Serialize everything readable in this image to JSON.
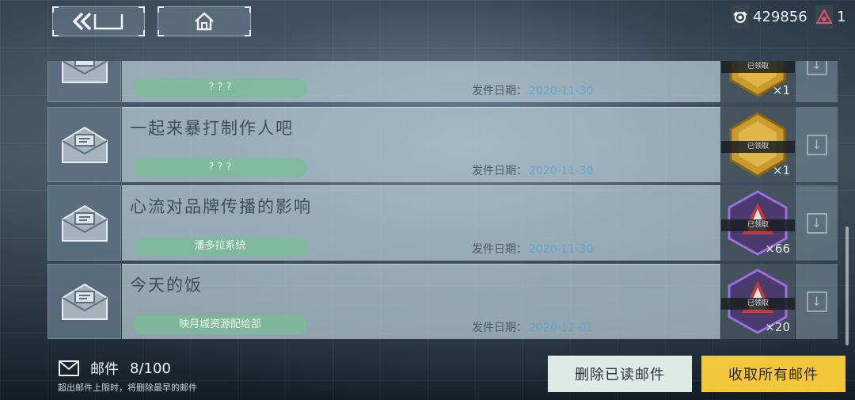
{
  "header": {
    "currency_1": "429856",
    "currency_2": "1"
  },
  "mails": [
    {
      "title": "",
      "sender": "? ? ?",
      "date_label": "发件日期：",
      "date": "2020-11-30",
      "reward_status": "已领取",
      "reward_count": "×1",
      "reward_type": "gold-coin"
    },
    {
      "title": "一起来暴打制作人吧",
      "sender": "? ? ?",
      "date_label": "发件日期：",
      "date": "2020-11-30",
      "reward_status": "已领取",
      "reward_count": "×1",
      "reward_type": "gold-coin"
    },
    {
      "title": "心流对品牌传播的影响",
      "sender": "潘多拉系统",
      "date_label": "发件日期：",
      "date": "2020-11-30",
      "reward_status": "已领取",
      "reward_count": "×66",
      "reward_type": "purple-crystal"
    },
    {
      "title": "今天的饭",
      "sender": "映月城资源配给部",
      "date_label": "发件日期：",
      "date": "2020-12-01",
      "reward_status": "已领取",
      "reward_count": "×20",
      "reward_type": "purple-crystal"
    }
  ],
  "footer": {
    "mail_label": "邮件",
    "mail_count": "8/100",
    "note": "超出邮件上限时，将删除最早的邮件",
    "delete_read_label": "删除已读邮件",
    "claim_all_label": "收取所有邮件"
  },
  "colors": {
    "claim_all_button": "#f3c73a",
    "delete_button": "#dfe9e6",
    "sender_pill": "#78be96",
    "date_text": "#5fa6cf"
  }
}
